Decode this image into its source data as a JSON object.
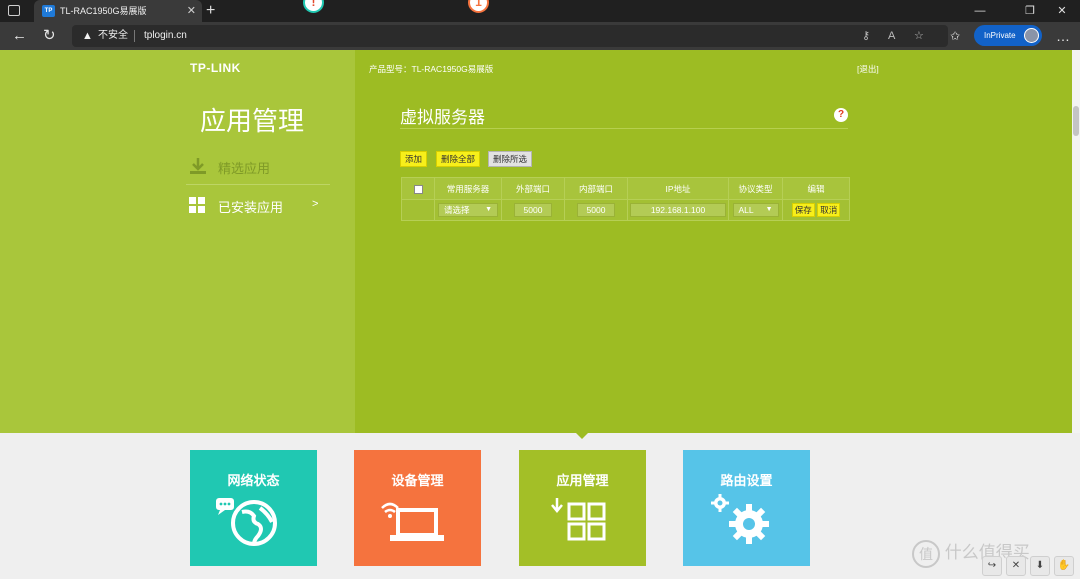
{
  "browser": {
    "tab_title": "TL-RAC1950G易展版",
    "tab_favicon": "TP",
    "insecure_label": "不安全",
    "url": "tplogin.cn",
    "inprivate_label": "InPrivate",
    "accent_color": "#1262c8"
  },
  "header": {
    "logo": "TP-LINK",
    "model": "产品型号：TL-RAC1950G易展版",
    "logout": "[退出]"
  },
  "sidebar": {
    "title": "应用管理",
    "items": [
      {
        "label": "精选应用",
        "icon": "download-icon"
      },
      {
        "label": "已安装应用",
        "icon": "grid-icon",
        "arrow": ">"
      }
    ]
  },
  "main": {
    "title": "虚拟服务器",
    "help": "?",
    "buttons": {
      "add": "添加",
      "delete_all": "删除全部",
      "delete_selected": "删除所选"
    },
    "table": {
      "headers": [
        "常用服务器",
        "外部端口",
        "内部端口",
        "IP地址",
        "协议类型",
        "编辑"
      ],
      "row": {
        "server": "请选择",
        "external_port": "5000",
        "internal_port": "5000",
        "ip": "192.168.1.100",
        "protocol": "ALL",
        "save": "保存",
        "cancel": "取消"
      }
    }
  },
  "tiles": [
    {
      "label": "网络状态",
      "color": "#20c8b2",
      "badge": "!",
      "icon": "globe-icon"
    },
    {
      "label": "设备管理",
      "color": "#f5733e",
      "badge": "1",
      "icon": "laptop-icon"
    },
    {
      "label": "应用管理",
      "color": "#a3bf27",
      "icon": "apps-icon"
    },
    {
      "label": "路由设置",
      "color": "#56c4e8",
      "icon": "gears-icon"
    }
  ],
  "watermark": {
    "text": "什么值得买",
    "icon": "值"
  },
  "colors": {
    "page_green": "#a9c63b",
    "panel_green": "#9dbc23",
    "button_yellow": "#f7ef1a"
  }
}
